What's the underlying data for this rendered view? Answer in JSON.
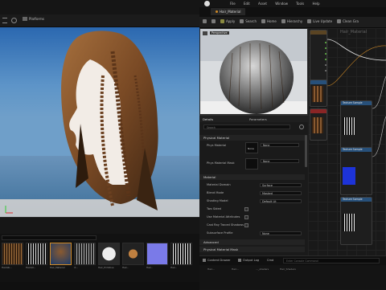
{
  "menu": {
    "items": [
      "File",
      "Edit",
      "Asset",
      "Window",
      "Tools",
      "Help"
    ]
  },
  "tabs": {
    "active": "Hair_Material"
  },
  "left_toolbar": {
    "platforms": "Platforms"
  },
  "toolbar": {
    "apply": "Apply",
    "search": "Search",
    "home": "Home",
    "hierarchy": "Hierarchy",
    "live_update": "Live Update",
    "clean": "Clean Gra"
  },
  "preview": {
    "label": "Perspective"
  },
  "details": {
    "tab_details": "Details",
    "tab_parameters": "Parameters",
    "search_placeholder": "Search",
    "physical_section": "Physical Material",
    "phys_material_label": "Phys Material",
    "phys_material_value": "None",
    "phys_mask_label": "Phys Material Mask",
    "phys_mask_value": "None",
    "none_label": "None",
    "material_section": "Material",
    "rows": [
      {
        "label": "Material Domain",
        "value": "Surface"
      },
      {
        "label": "Blend Mode",
        "value": "Masked"
      },
      {
        "label": "Shading Model",
        "value": "Default Lit"
      },
      {
        "label": "Two Sided",
        "value": ""
      },
      {
        "label": "Use Material Attributes",
        "value": ""
      },
      {
        "label": "Cast Ray Traced Shadows",
        "value": ""
      },
      {
        "label": "Subsurface Profile",
        "value": "None"
      }
    ],
    "advanced_section": "Advanced",
    "physical_mask_section": "Physical Material Mask"
  },
  "graph": {
    "title": "Hair_Material",
    "nodes": [
      {
        "title": "Texture Sample"
      },
      {
        "title": "Texture Sample"
      },
      {
        "title": "Texture Sample"
      },
      {
        "title": "Texture Sample"
      }
    ],
    "pin_label": "Apply View MipBias"
  },
  "content_browser": {
    "assets": [
      {
        "label": "HairAlb..."
      },
      {
        "label": "HairAO..."
      },
      {
        "label": "Hair_Material"
      },
      {
        "label": "rt..."
      },
      {
        "label": "Hair_Primitive"
      },
      {
        "label": "Hair..."
      },
      {
        "label": "Hair..."
      },
      {
        "label": "Hair..."
      }
    ]
  },
  "bottom_bar": {
    "content_drawer": "Content Drawer",
    "output_log": "Output Log",
    "cmd": "Cmd",
    "console_placeholder": "Enter Console Command"
  },
  "bottom_strip": {
    "items": [
      "Hair...",
      "Hair...",
      "..._shaders",
      "Hair_Shaders"
    ]
  },
  "colors": {
    "sky": "#1d5aa0",
    "hair": "#7a4a25",
    "accent_orange": "#d08a26",
    "node_red": "#8a2525",
    "node_blue": "#27507a",
    "pin_green": "#66c04b"
  }
}
